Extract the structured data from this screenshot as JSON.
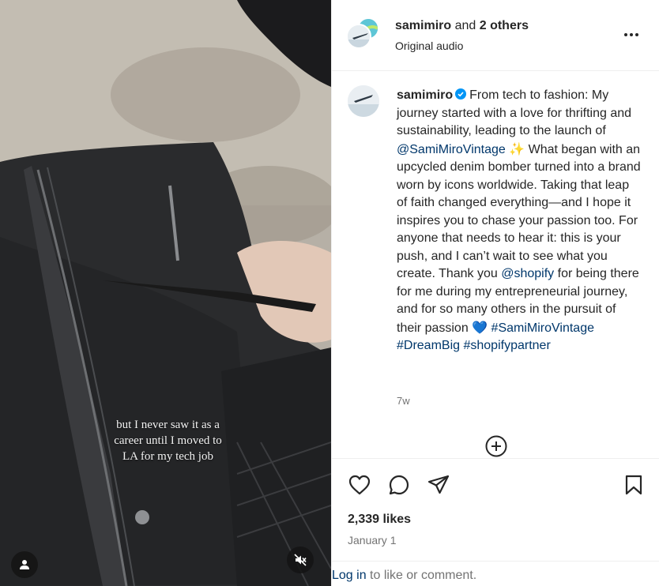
{
  "post": {
    "header": {
      "owner": "samimiro",
      "coauthor_connector": " and ",
      "coauthors": "2 others",
      "audio": "Original audio"
    },
    "media": {
      "overlay_caption": "but I never saw it as a\ncareer until I moved to\nLA for my tech job",
      "user_tag_icon": "user-icon",
      "mute_icon": "muted-speaker-icon"
    },
    "caption": {
      "username": "samimiro",
      "verified_icon": "verified-badge-icon",
      "text_1": "From tech to fashion: My journey started with a love for thrifting and sustainability, leading to the launch of ",
      "mention_1": "@SamiMiroVintage",
      "emoji_1": "✨",
      "text_2": " What began with an upcycled denim bomber turned into a brand worn by icons worldwide. Taking that leap of faith changed everything—and I hope it inspires you to chase your passion too. For anyone that needs to hear it: this is your push, and I can’t wait to see what you create. Thank you ",
      "mention_2": "@shopify",
      "text_3": " for being there for me during my entrepreneurial journey, and for so many others in the pursuit of their passion ",
      "emoji_2": "💙",
      "hashtag_1": "#SamiMiroVintage",
      "hashtag_2": "#DreamBig",
      "hashtag_3": "#shopifypartner",
      "time_ago": "7w"
    },
    "load_more_icon": "plus-circle-icon",
    "actions": {
      "like_icon": "heart-icon",
      "comment_icon": "comment-icon",
      "share_icon": "paper-plane-icon",
      "save_icon": "bookmark-icon"
    },
    "likes": "2,339 likes",
    "date": "January 1",
    "login_prompt": {
      "link": "Log in",
      "rest": " to like or comment."
    }
  },
  "colors": {
    "link": "#00376b",
    "text": "#262626",
    "muted": "#737373",
    "divider": "#efefef",
    "verified": "#0095f6"
  }
}
